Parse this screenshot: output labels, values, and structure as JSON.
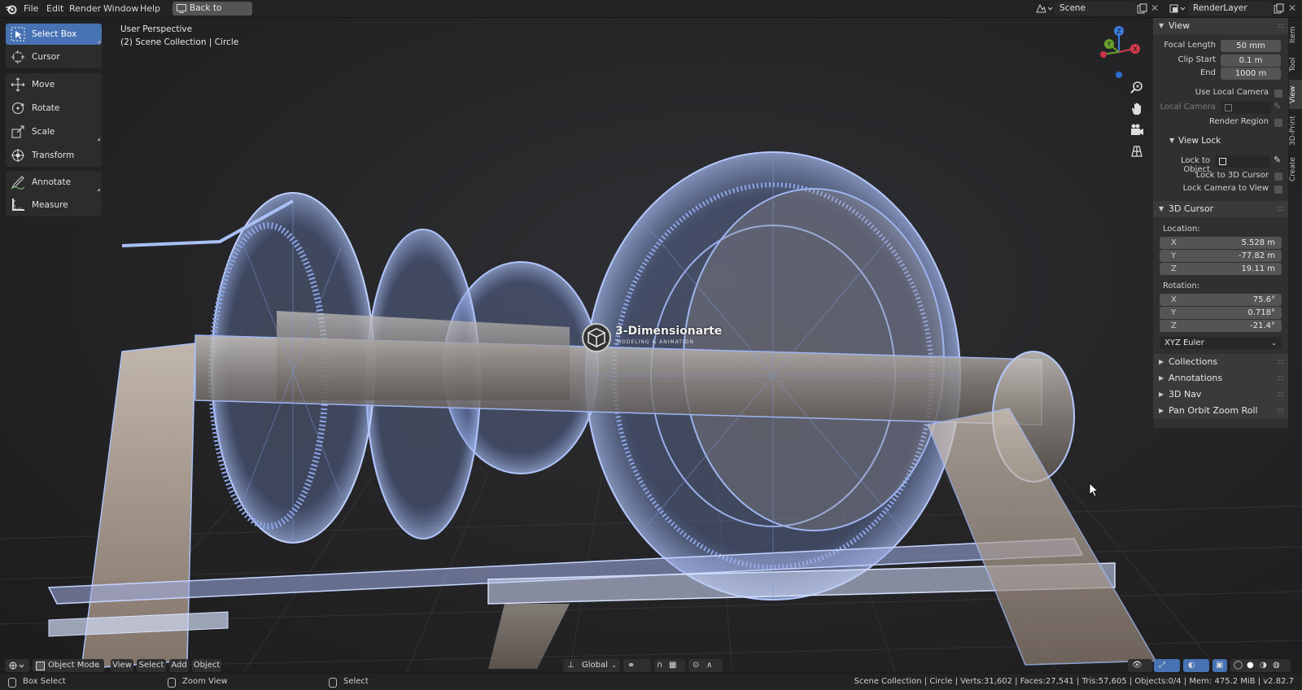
{
  "menu": [
    "File",
    "Edit",
    "Render",
    "Window",
    "Help"
  ],
  "back_button": "Back to Previous",
  "scene": {
    "name": "Scene"
  },
  "render_layer": {
    "name": "RenderLayer"
  },
  "viewport": {
    "perspective": "User Perspective",
    "collection": "(2) Scene Collection | Circle",
    "watermark_title": "3-Dimensionarte",
    "watermark_sub": "MODELING & ANIMATION",
    "gizmo": {
      "z": "Z",
      "y": "Y",
      "x": "X"
    }
  },
  "tools": {
    "select_box": "Select Box",
    "cursor": "Cursor",
    "move": "Move",
    "rotate": "Rotate",
    "scale": "Scale",
    "transform": "Transform",
    "annotate": "Annotate",
    "measure": "Measure"
  },
  "npanel": {
    "view": {
      "title": "View",
      "focal_length_label": "Focal Length",
      "focal_length": "50 mm",
      "clip_start_label": "Clip Start",
      "clip_start": "0.1 m",
      "end_label": "End",
      "end": "1000 m",
      "use_local_camera": "Use Local Camera",
      "local_camera": "Local Camera",
      "render_region": "Render Region"
    },
    "view_lock": {
      "title": "View Lock",
      "lock_to_object": "Lock to Object",
      "lock_to_3d_cursor": "Lock to 3D Cursor",
      "lock_camera_to_view": "Lock Camera to View"
    },
    "cursor": {
      "title": "3D Cursor",
      "location_label": "Location:",
      "loc": {
        "x": "5.528 m",
        "y": "-77.82 m",
        "z": "19.11 m"
      },
      "rotation_label": "Rotation:",
      "rot": {
        "x": "75.6°",
        "y": "0.718°",
        "z": "-21.4°"
      },
      "axis": {
        "x": "X",
        "y": "Y",
        "z": "Z"
      },
      "rotation_mode": "XYZ Euler"
    },
    "collapsed": [
      "Collections",
      "Annotations",
      "3D Nav",
      "Pan Orbit Zoom Roll"
    ]
  },
  "side_tabs": [
    "Item",
    "Tool",
    "View",
    "3D-Print",
    "Create"
  ],
  "bottom": {
    "mode": "Object Mode",
    "view": "View",
    "select": "Select",
    "add": "Add",
    "object": "Object",
    "orientation": "Global"
  },
  "status": {
    "left": "Box Select",
    "middle": "Zoom View",
    "right_action": "Select",
    "stats": "Scene Collection | Circle | Verts:31,602 | Faces:27,541 | Tris:57,605 | Objects:0/4 | Mem: 475.2 MiB | v2.82.7"
  }
}
